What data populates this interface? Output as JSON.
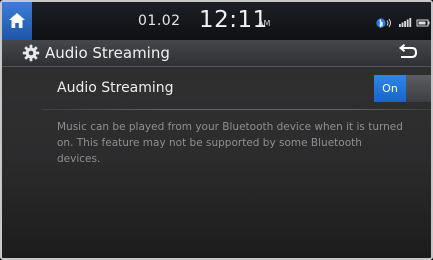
{
  "status_bar": {
    "date": "01.02",
    "time": "12:11",
    "ampm": "AM",
    "icons": [
      "bluetooth-audio-icon",
      "signal-strength-icon",
      "battery-icon"
    ]
  },
  "title_bar": {
    "icon": "gear-icon",
    "title": "Audio Streaming",
    "back_icon": "back-arrow-icon"
  },
  "setting": {
    "label": "Audio Streaming",
    "toggle_label": "On",
    "toggle_state": "on"
  },
  "description": "Music can be played from your Bluetooth device when it is turned on. This feature may not be supported by some Bluetooth devices.",
  "colors": {
    "accent": "#1f6fd6",
    "home_button": "#2a66c2",
    "text_primary": "#eeeeee",
    "text_secondary": "#8e8f92"
  }
}
